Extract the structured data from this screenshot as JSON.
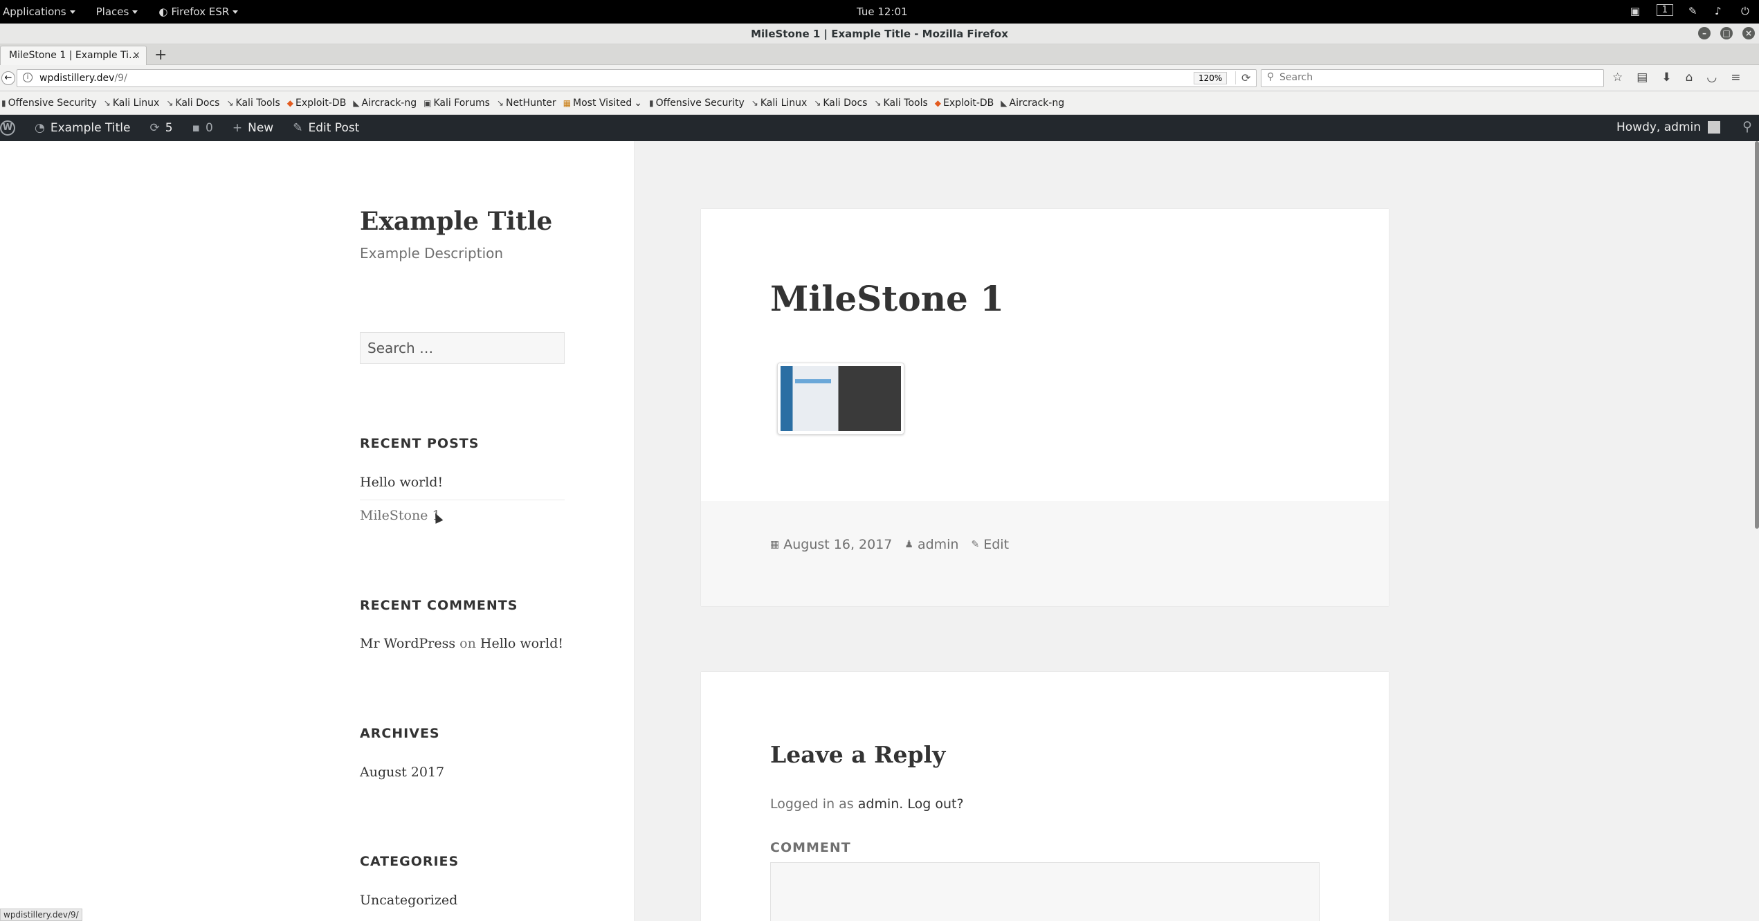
{
  "gnome": {
    "applications": "Applications",
    "places": "Places",
    "firefox": "Firefox ESR",
    "clock": "Tue 12:01",
    "workspace": "1"
  },
  "window": {
    "title": "MileStone 1 | Example Title - Mozilla Firefox"
  },
  "tab": {
    "label": "MileStone 1 | Example Ti..."
  },
  "nav": {
    "url_host": "wpdistillery.dev",
    "url_path": "/9/",
    "zoom": "120%",
    "search_placeholder": "Search"
  },
  "bookmarks": [
    {
      "label": "Offensive Security",
      "icon": "offsec-icon"
    },
    {
      "label": "Kali Linux",
      "icon": "kali-icon"
    },
    {
      "label": "Kali Docs",
      "icon": "kali-icon"
    },
    {
      "label": "Kali Tools",
      "icon": "kali-icon"
    },
    {
      "label": "Exploit-DB",
      "icon": "exploitdb-icon"
    },
    {
      "label": "Aircrack-ng",
      "icon": "aircrack-icon"
    },
    {
      "label": "Kali Forums",
      "icon": "forums-icon"
    },
    {
      "label": "NetHunter",
      "icon": "kali-icon"
    },
    {
      "label": "Most Visited",
      "icon": "folder-icon"
    },
    {
      "label": "Offensive Security",
      "icon": "offsec-icon"
    },
    {
      "label": "Kali Linux",
      "icon": "kali-icon"
    },
    {
      "label": "Kali Docs",
      "icon": "kali-icon"
    },
    {
      "label": "Kali Tools",
      "icon": "kali-icon"
    },
    {
      "label": "Exploit-DB",
      "icon": "exploitdb-icon"
    },
    {
      "label": "Aircrack-ng",
      "icon": "aircrack-icon"
    }
  ],
  "wpbar": {
    "site_name": "Example Title",
    "updates": "5",
    "comments": "0",
    "new": "New",
    "edit_post": "Edit Post",
    "howdy": "Howdy, admin"
  },
  "sidebar": {
    "site_title": "Example Title",
    "site_description": "Example Description",
    "search_placeholder": "Search …",
    "recent_posts_title": "RECENT POSTS",
    "recent_posts": [
      "Hello world!",
      "MileStone 1"
    ],
    "recent_comments_title": "RECENT COMMENTS",
    "comment_author": "Mr WordPress",
    "comment_on": "on",
    "comment_post": "Hello world!",
    "archives_title": "ARCHIVES",
    "archive_item": "August 2017",
    "categories_title": "CATEGORIES",
    "category_item": "Uncategorized"
  },
  "post": {
    "title": "MileStone 1",
    "date": "August 16, 2017",
    "author": "admin",
    "edit": "Edit"
  },
  "reply": {
    "title": "Leave a Reply",
    "logged_in_prefix": "Logged in as",
    "user": "admin.",
    "logout": "Log out?",
    "comment_label": "COMMENT"
  },
  "status": {
    "url": "wpdistillery.dev/9/"
  }
}
